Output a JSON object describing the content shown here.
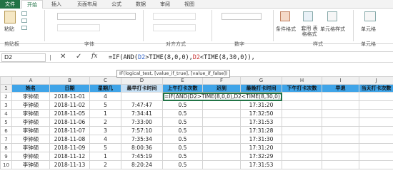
{
  "ribbon": {
    "tabs": [
      "文件",
      "开始",
      "插入",
      "页面布局",
      "公式",
      "数据",
      "审阅",
      "视图"
    ],
    "paste_label": "粘贴",
    "clipboard_label": "剪贴板",
    "font_label": "字体",
    "align_label": "对齐方式",
    "number_label": "数字",
    "conditional_label": "条件格式",
    "table_format_label": "套用\n表格格式",
    "cell_style_label": "单元格样式",
    "style_label": "样式",
    "cells_label": "单元格",
    "cell_btn_label": "单元格"
  },
  "formula_bar": {
    "name_box": "D2",
    "fx": "fx",
    "formula_prefix": "=IF(AND(",
    "ref1": "D2",
    "formula_mid": ">TIME(8,0,0),",
    "ref2": "D2",
    "formula_suffix": "<TIME(8,30,0)),"
  },
  "tooltip": "IF(logical_test, [value_if_true], [value_if_false])",
  "grid": {
    "columns": [
      "A",
      "B",
      "C",
      "D",
      "E",
      "F",
      "G",
      "H",
      "I",
      "J"
    ],
    "headers": [
      "姓名",
      "日期",
      "星期几",
      "最早打卡时间",
      "上午打卡次数",
      "迟到",
      "最晚打卡时间",
      "下午打卡次数",
      "早退",
      "当天打卡次数"
    ],
    "edit_text": "=IF(AND(D2>TIME(8,0,0),D2<TIME(8,30,0)),",
    "rows": [
      {
        "num": "3",
        "name": "李钟硕",
        "date": "2018-11-02",
        "week": "5",
        "early": "7:47:47",
        "am": "0.5",
        "late": "17:31:20"
      },
      {
        "num": "4",
        "name": "李钟硕",
        "date": "2018-11-05",
        "week": "1",
        "early": "7:34:41",
        "am": "0.5",
        "late": "17:32:50"
      },
      {
        "num": "5",
        "name": "李钟硕",
        "date": "2018-11-06",
        "week": "2",
        "early": "7:33:00",
        "am": "0.5",
        "late": "17:31:53"
      },
      {
        "num": "6",
        "name": "李钟硕",
        "date": "2018-11-07",
        "week": "3",
        "early": "7:57:10",
        "am": "0.5",
        "late": "17:31:28"
      },
      {
        "num": "7",
        "name": "李钟硕",
        "date": "2018-11-08",
        "week": "4",
        "early": "7:35:34",
        "am": "0.5",
        "late": "17:31:30"
      },
      {
        "num": "8",
        "name": "李钟硕",
        "date": "2018-11-09",
        "week": "5",
        "early": "8:00:36",
        "am": "0.5",
        "late": "17:31:20"
      },
      {
        "num": "9",
        "name": "李钟硕",
        "date": "2018-11-12",
        "week": "1",
        "early": "7:45:19",
        "am": "0.5",
        "late": "17:32:29"
      },
      {
        "num": "10",
        "name": "李钟硕",
        "date": "2018-11-13",
        "week": "2",
        "early": "8:20:24",
        "am": "0.5",
        "late": "17:31:53"
      }
    ],
    "row2": {
      "num": "2",
      "name": "李钟硕",
      "date": "2018-11-01",
      "week": "4"
    }
  }
}
